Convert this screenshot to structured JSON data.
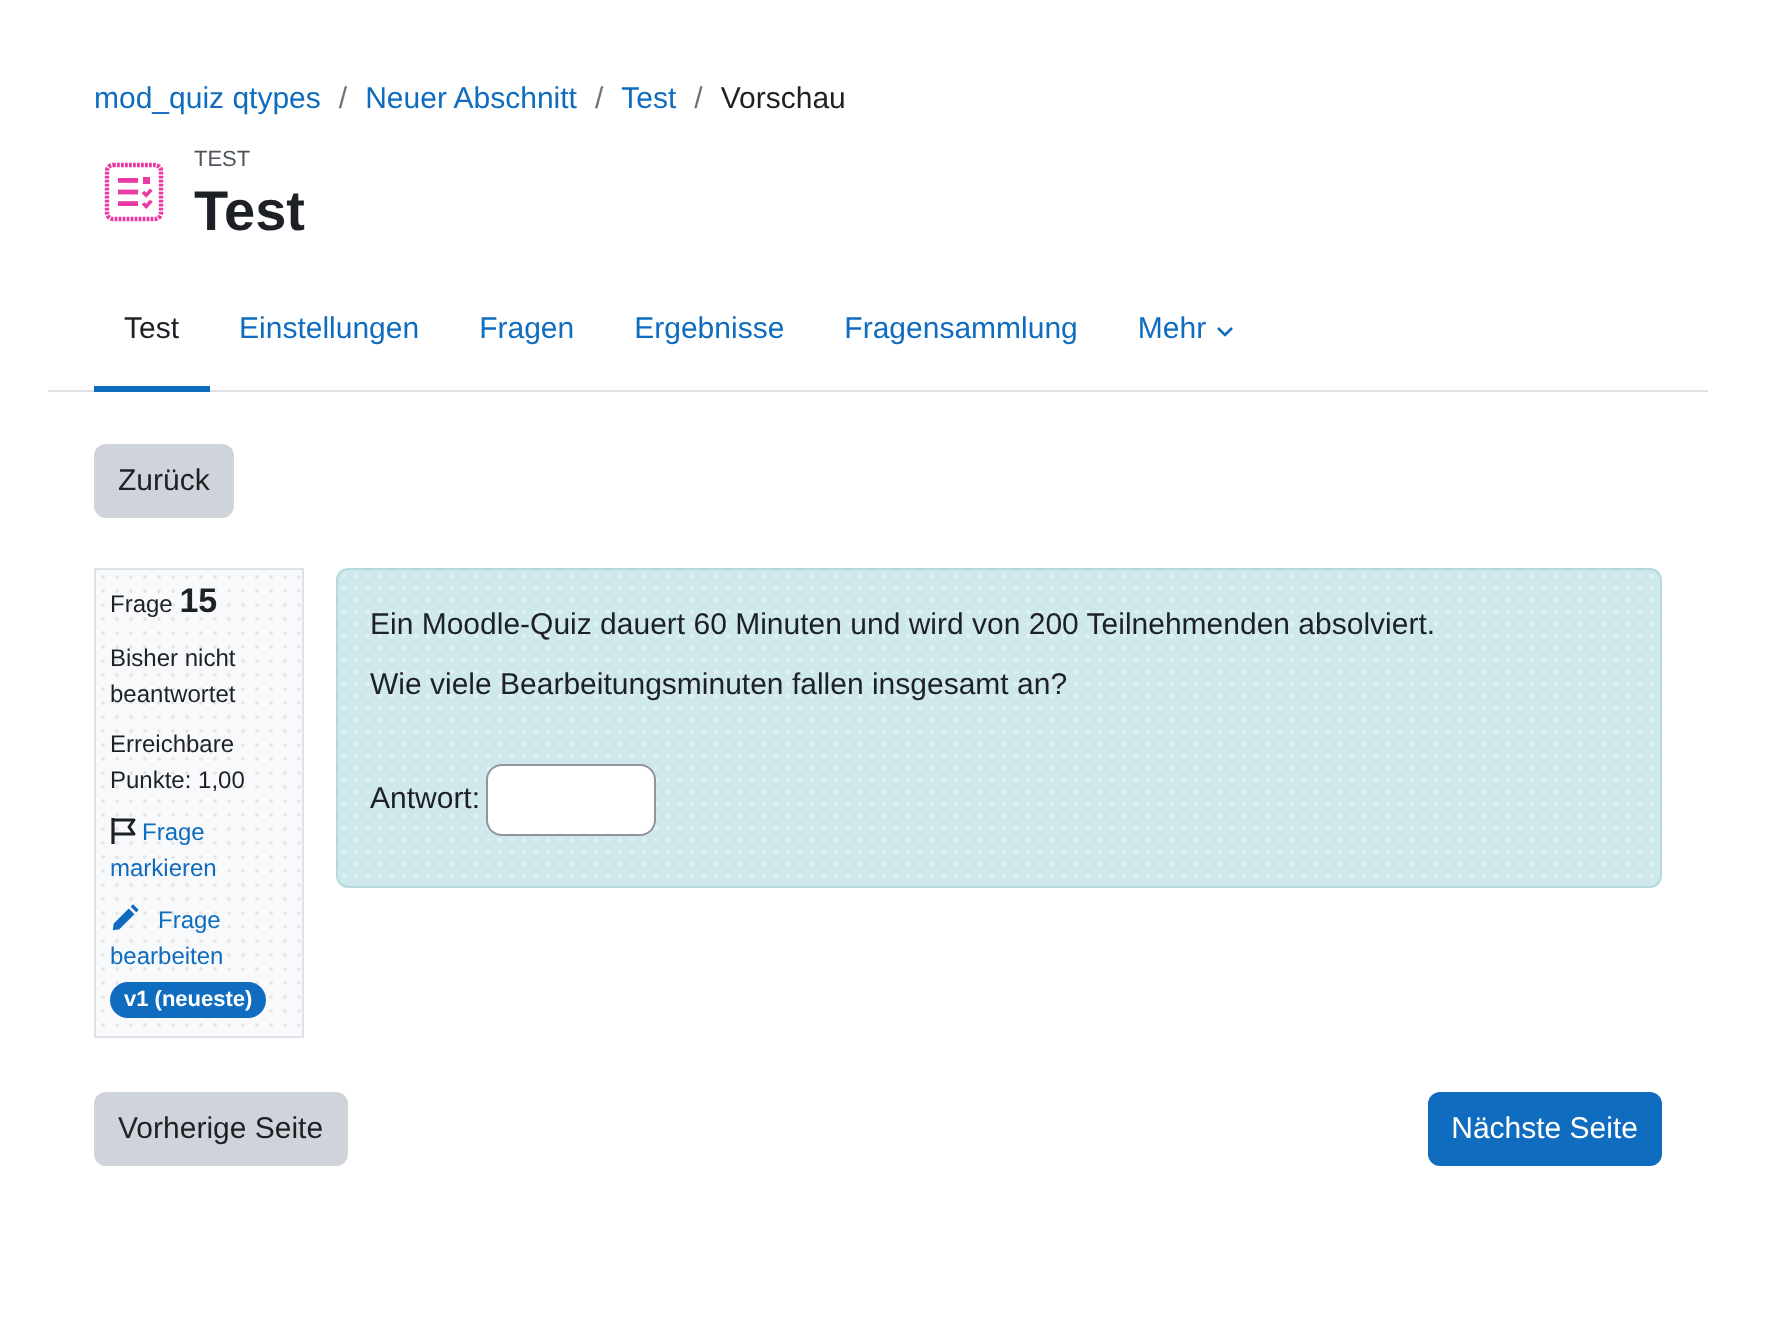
{
  "breadcrumb": [
    {
      "kind": "link",
      "label": "mod_quiz qtypes"
    },
    {
      "kind": "separator",
      "label": "/"
    },
    {
      "kind": "link",
      "label": "Neuer Abschnitt"
    },
    {
      "kind": "separator",
      "label": "/"
    },
    {
      "kind": "link",
      "label": "Test"
    },
    {
      "kind": "separator",
      "label": "/"
    },
    {
      "kind": "current",
      "label": "Vorschau"
    }
  ],
  "header": {
    "module_type": "TEST",
    "title": "Test"
  },
  "tabs": [
    {
      "label": "Test",
      "selected": true,
      "dropdown": false
    },
    {
      "label": "Einstellungen",
      "selected": false,
      "dropdown": false
    },
    {
      "label": "Fragen",
      "selected": false,
      "dropdown": false
    },
    {
      "label": "Ergebnisse",
      "selected": false,
      "dropdown": false
    },
    {
      "label": "Fragensammlung",
      "selected": false,
      "dropdown": false
    },
    {
      "label": "Mehr",
      "selected": false,
      "dropdown": true
    }
  ],
  "back_button": {
    "label": "Zurück"
  },
  "question_info": {
    "heading": "Frage **15**",
    "status": "Bisher nicht beantwortet",
    "marks": "Erreichbare Punkte: 1,00",
    "flag_link": "Frage markieren",
    "edit_link": "Frage bearbeiten",
    "version_badge": "v1 (neueste)"
  },
  "question": {
    "text": [
      "Ein Moodle-Quiz dauert 60 Minuten und wird von 200 Teilnehmenden absolviert.",
      "Wie viele Bearbeitungsminuten fallen insgesamt an?"
    ],
    "answer_label": "Antwort:"
  },
  "navigation": {
    "previous": "Vorherige Seite",
    "next": "Nächste Seite"
  }
}
